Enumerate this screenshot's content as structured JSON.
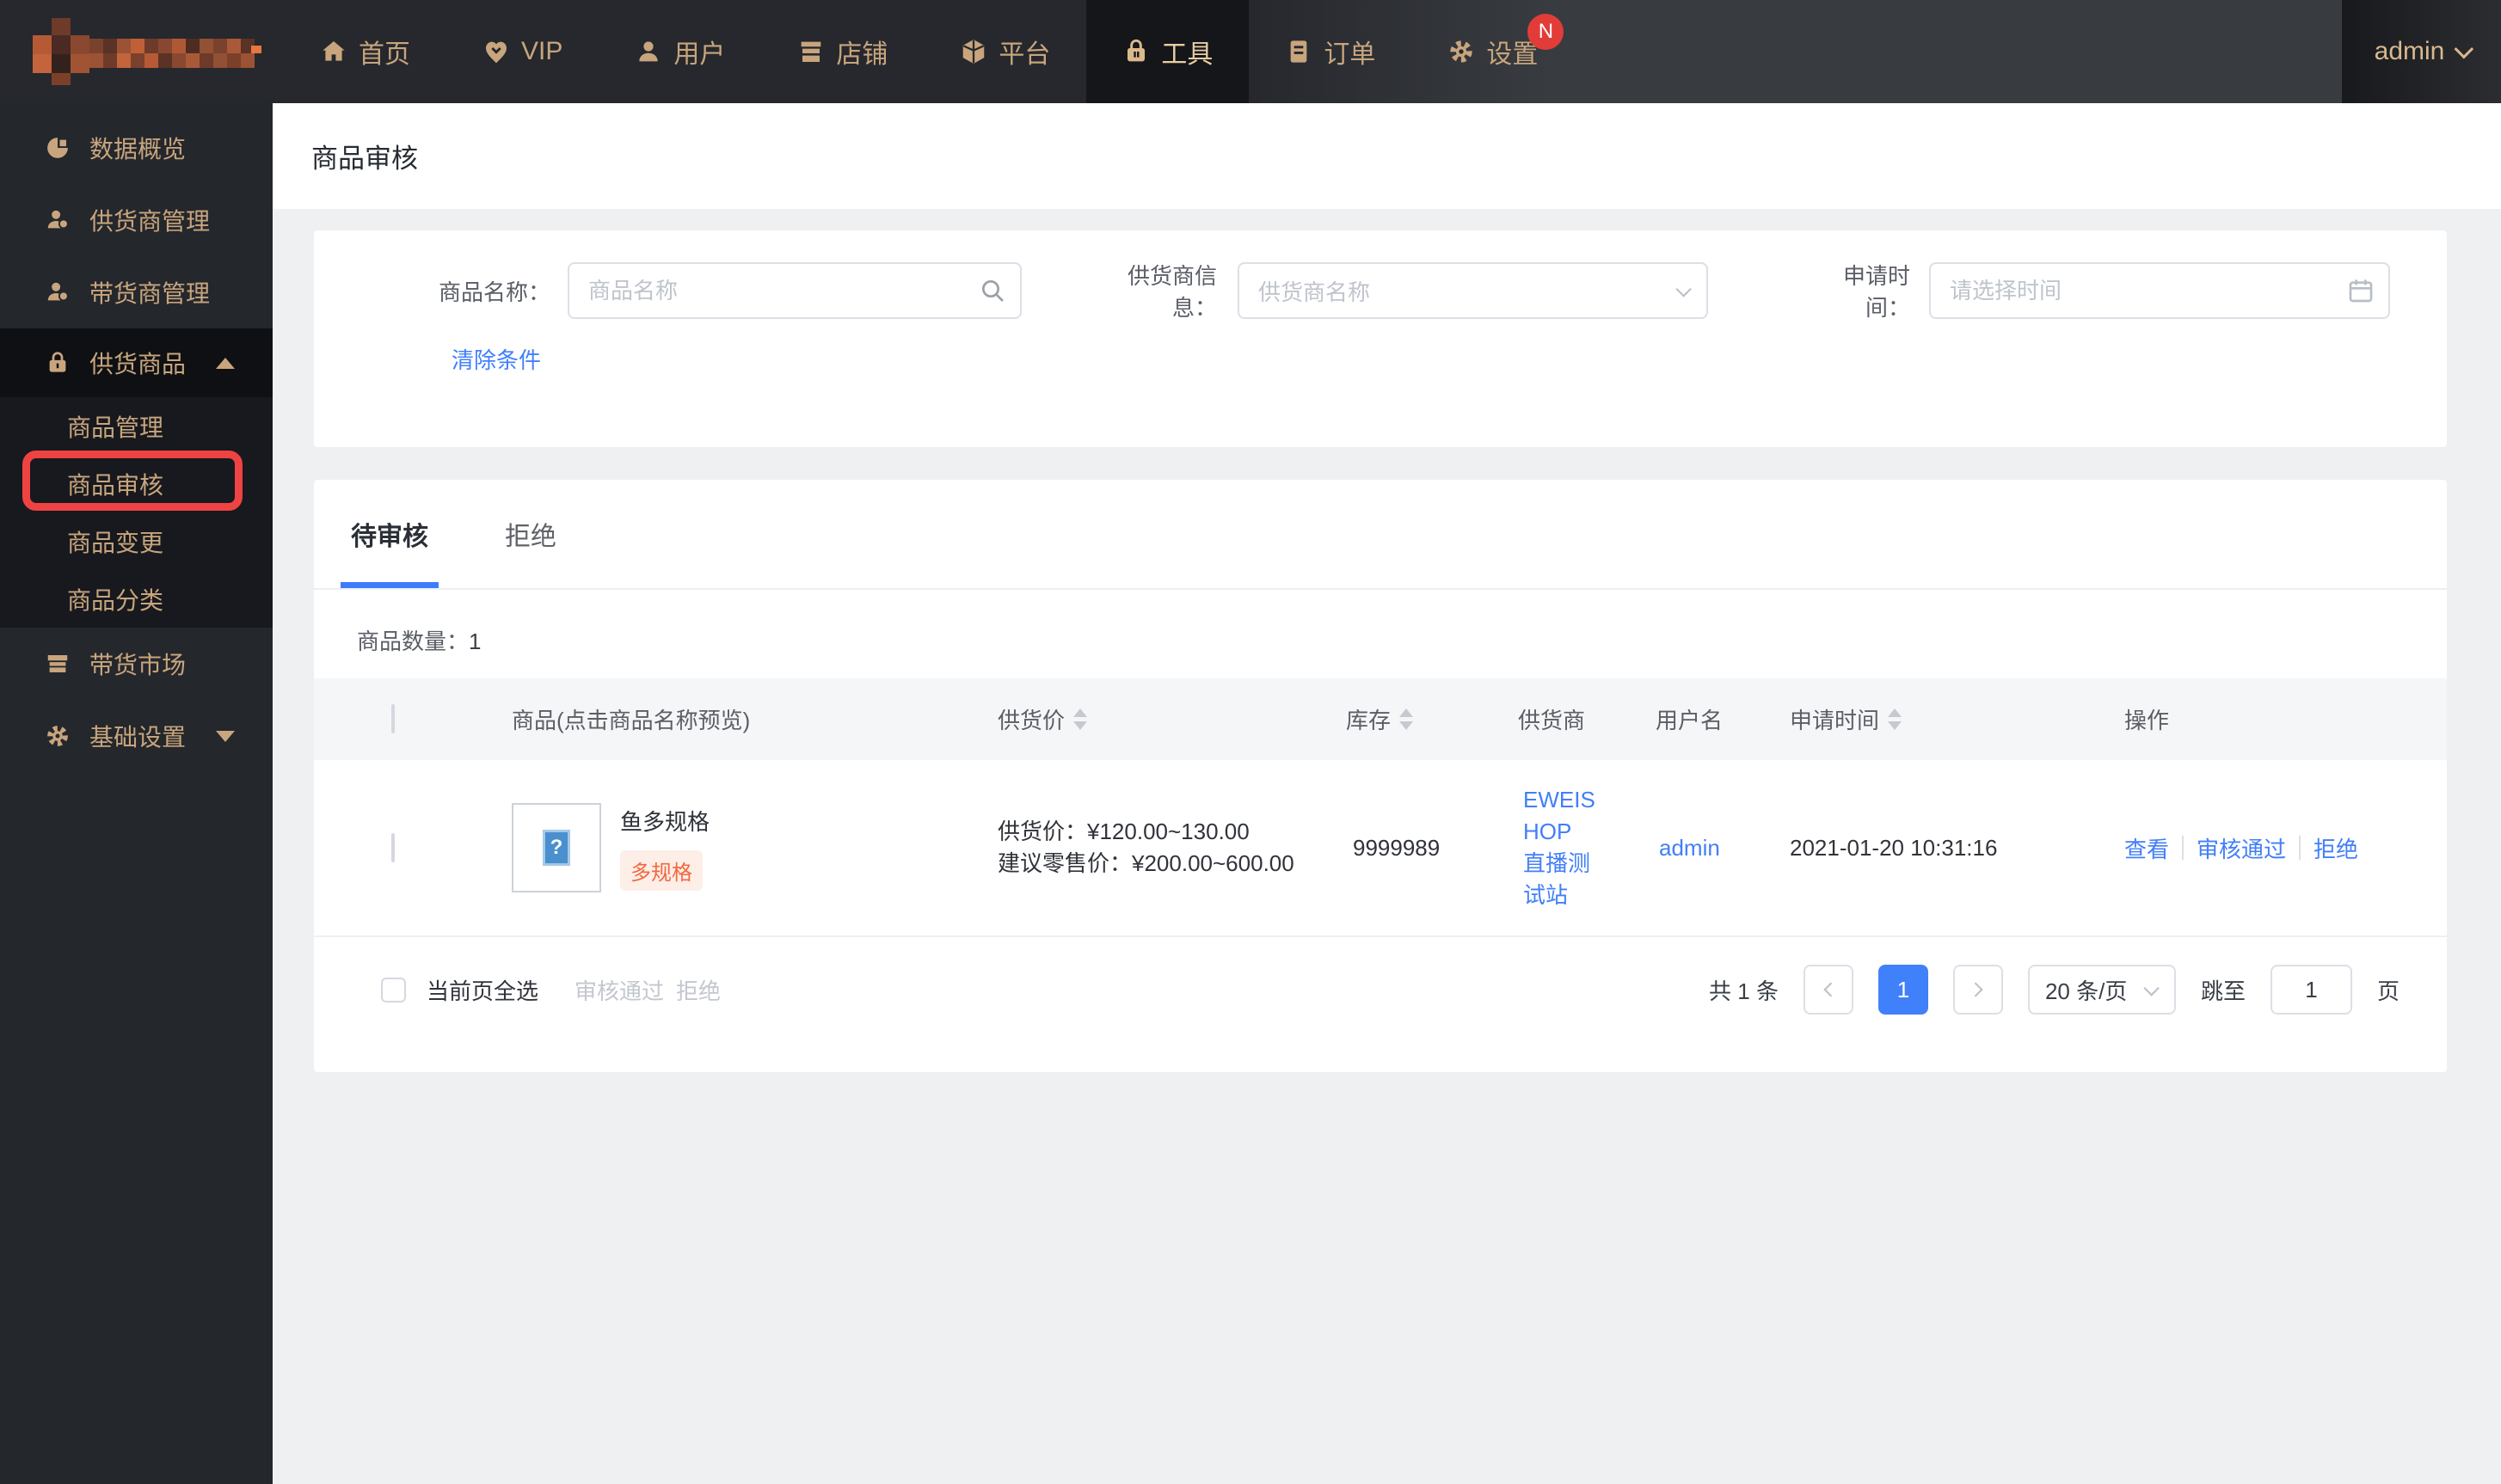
{
  "colors": {
    "accent_blue": "#4180fb",
    "brand_tan": "#c8a57d",
    "badge_red": "#e23c39",
    "tag_orange": "#f2683f",
    "annotation_red": "#ef4343"
  },
  "navbar": {
    "items": [
      "首页",
      "VIP",
      "用户",
      "店铺",
      "平台",
      "工具",
      "订单",
      "设置"
    ],
    "active": "工具",
    "badge": "N",
    "user": "admin"
  },
  "sidebar": {
    "overview": "数据概览",
    "supplier_mgmt": "供货商管理",
    "reseller_mgmt": "带货商管理",
    "supply_goods": "供货商品",
    "sub_product_mgmt": "商品管理",
    "sub_product_review": "商品审核",
    "sub_product_change": "商品变更",
    "sub_product_category": "商品分类",
    "reseller_market": "带货市场",
    "basic_settings": "基础设置"
  },
  "page": {
    "title": "商品审核"
  },
  "filters": {
    "product_name": {
      "label": "商品名称：",
      "placeholder": "商品名称"
    },
    "supplier": {
      "label": "供货商信息：",
      "placeholder": "供货商名称"
    },
    "apply_time": {
      "label": "申请时间：",
      "placeholder": "请选择时间"
    },
    "clear": "清除条件"
  },
  "tabs": {
    "pending": "待审核",
    "rejected": "拒绝"
  },
  "count": {
    "label": "商品数量：",
    "value": "1"
  },
  "table": {
    "columns": {
      "product": "商品(点击商品名称预览)",
      "supply_price": "供货价",
      "stock": "库存",
      "supplier": "供货商",
      "username": "用户名",
      "apply_time": "申请时间",
      "action": "操作"
    },
    "row": {
      "name": "鱼多规格",
      "tag": "多规格",
      "price_label": "供货价：",
      "price_value": "¥120.00~130.00",
      "retail_label": "建议零售价：",
      "retail_value": "¥200.00~600.00",
      "stock": "9999989",
      "supplier_lines": [
        "EWEIS",
        "HOP",
        "直播测",
        "试站"
      ],
      "username": "admin",
      "apply_time": "2021-01-20 10:31:16",
      "action_view": "查看",
      "action_approve": "审核通过",
      "action_reject": "拒绝"
    }
  },
  "footer": {
    "select_all": "当前页全选",
    "approve": "审核通过",
    "reject": "拒绝"
  },
  "pagination": {
    "total": "共 1 条",
    "page": "1",
    "page_size": "20 条/页",
    "jump_label": "跳至",
    "jump_value": "1",
    "jump_unit": "页"
  }
}
